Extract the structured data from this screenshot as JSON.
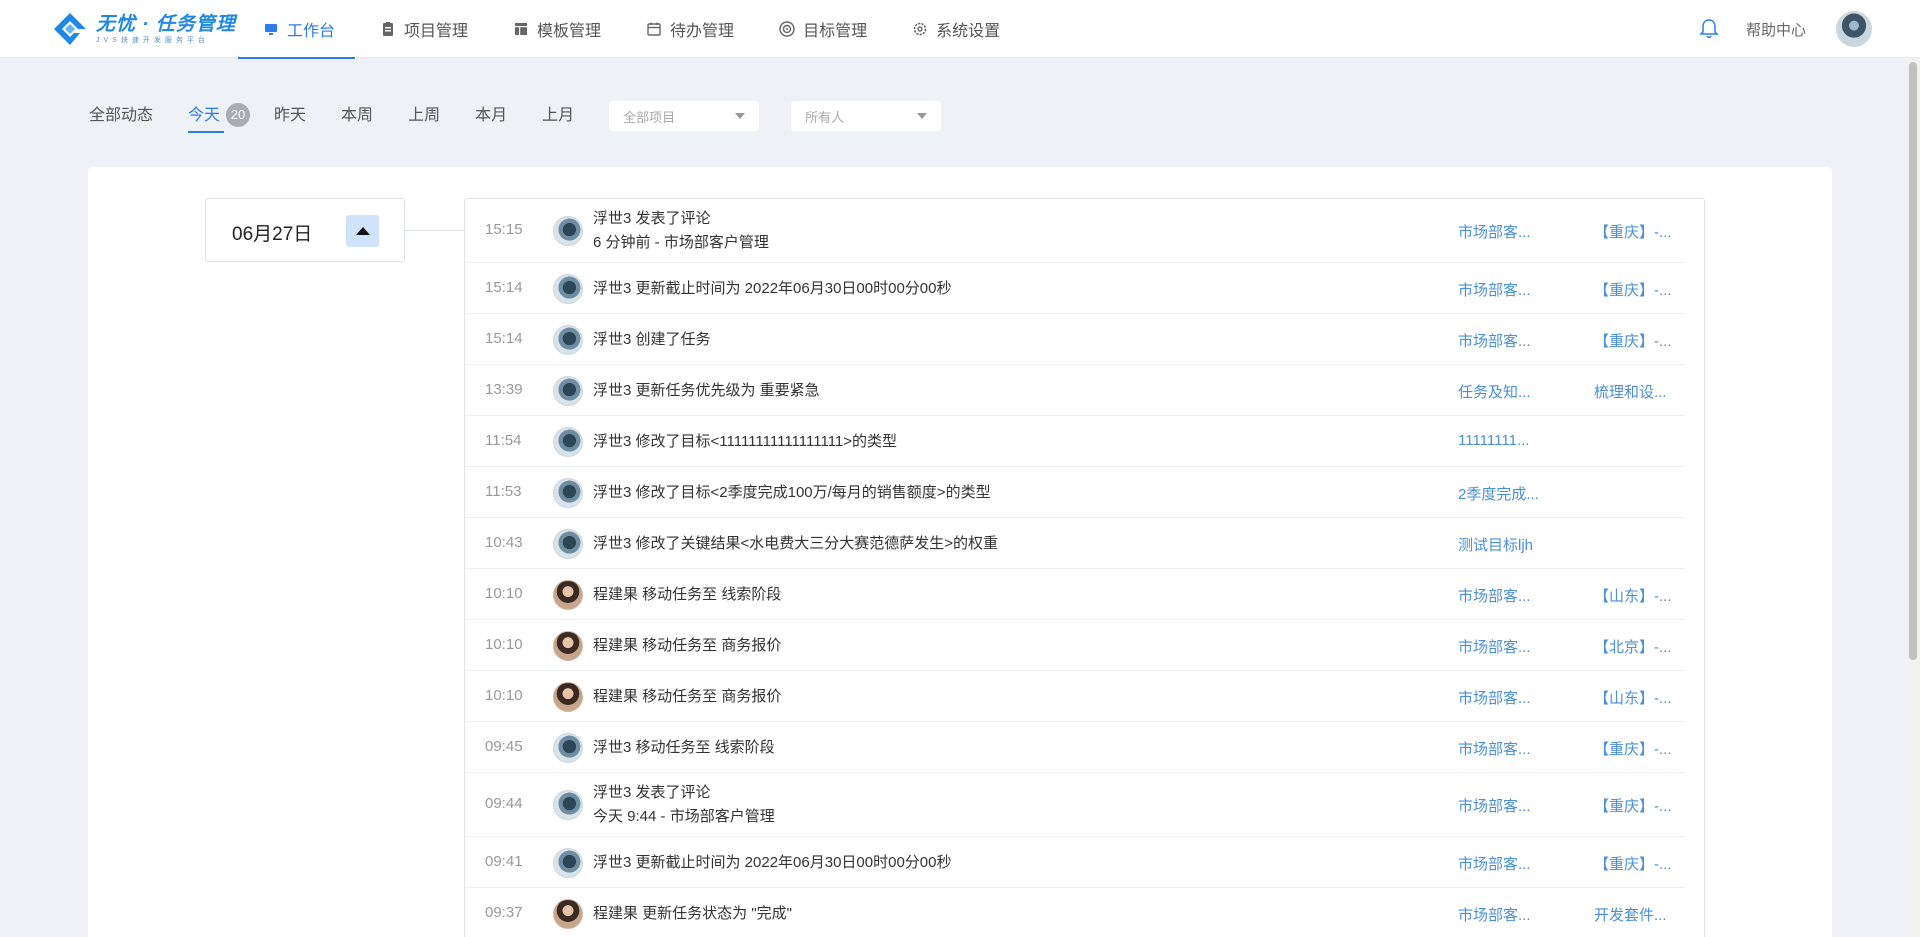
{
  "app": {
    "logo_title": "无忧 · 任务管理",
    "logo_sub": "JVS快速开发服务平台"
  },
  "nav": [
    {
      "label": "工作台",
      "icon": "monitor-icon"
    },
    {
      "label": "项目管理",
      "icon": "clipboard-icon"
    },
    {
      "label": "模板管理",
      "icon": "template-icon"
    },
    {
      "label": "待办管理",
      "icon": "calendar-icon"
    },
    {
      "label": "目标管理",
      "icon": "target-icon"
    },
    {
      "label": "系统设置",
      "icon": "gear-icon"
    }
  ],
  "header": {
    "help_label": "帮助中心",
    "bell_icon": "bell-icon",
    "accent": "#2b7de9"
  },
  "filters": {
    "tabs": [
      "全部动态",
      "今天",
      "昨天",
      "本周",
      "上周",
      "本月",
      "上月"
    ],
    "active": "今天",
    "today_count": "20",
    "project_placeholder": "全部项目",
    "person_placeholder": "所有人"
  },
  "date_group": {
    "date": "06月27日"
  },
  "activities": [
    {
      "time": "15:15",
      "user": "fushi",
      "text": "浮世3 发表了评论",
      "sub": "6 分钟前 - 市场部客户管理",
      "link1": "市场部客...",
      "link2": "【重庆】-..."
    },
    {
      "time": "15:14",
      "user": "fushi",
      "text": "浮世3 更新截止时间为 2022年06月30日00时00分00秒",
      "sub": "",
      "link1": "市场部客...",
      "link2": "【重庆】-..."
    },
    {
      "time": "15:14",
      "user": "fushi",
      "text": "浮世3 创建了任务",
      "sub": "",
      "link1": "市场部客...",
      "link2": "【重庆】-..."
    },
    {
      "time": "13:39",
      "user": "fushi",
      "text": "浮世3 更新任务优先级为 重要紧急",
      "sub": "",
      "link1": "任务及知...",
      "link2": "梳理和设..."
    },
    {
      "time": "11:54",
      "user": "fushi",
      "text": "浮世3 修改了目标<11111111111111111>的类型",
      "sub": "",
      "link1": " 11111111...",
      "link2": ""
    },
    {
      "time": "11:53",
      "user": "fushi",
      "text": "浮世3 修改了目标<2季度完成100万/每月的销售额度>的类型",
      "sub": "",
      "link1": "2季度完成...",
      "link2": ""
    },
    {
      "time": "10:43",
      "user": "fushi",
      "text": "浮世3 修改了关键结果<水电费大三分大赛范德萨发生>的权重",
      "sub": "",
      "link1": " 测试目标ljh",
      "link2": ""
    },
    {
      "time": "10:10",
      "user": "cheng",
      "text": "程建果 移动任务至 线索阶段",
      "sub": "",
      "link1": "市场部客...",
      "link2": "【山东】-..."
    },
    {
      "time": "10:10",
      "user": "cheng",
      "text": "程建果 移动任务至 商务报价",
      "sub": "",
      "link1": "市场部客...",
      "link2": "【北京】-..."
    },
    {
      "time": "10:10",
      "user": "cheng",
      "text": "程建果 移动任务至 商务报价",
      "sub": "",
      "link1": "市场部客...",
      "link2": "【山东】-..."
    },
    {
      "time": "09:45",
      "user": "fushi",
      "text": "浮世3 移动任务至 线索阶段",
      "sub": "",
      "link1": "市场部客...",
      "link2": "【重庆】-..."
    },
    {
      "time": "09:44",
      "user": "fushi",
      "text": "浮世3 发表了评论",
      "sub": "今天 9:44 - 市场部客户管理",
      "link1": "市场部客...",
      "link2": "【重庆】-..."
    },
    {
      "time": "09:41",
      "user": "fushi",
      "text": "浮世3 更新截止时间为 2022年06月30日00时00分00秒",
      "sub": "",
      "link1": "市场部客...",
      "link2": "【重庆】-..."
    },
    {
      "time": "09:37",
      "user": "cheng",
      "text": "程建果 更新任务状态为 \"完成\"",
      "sub": "",
      "link1": "市场部客...",
      "link2": "开发套件..."
    }
  ]
}
